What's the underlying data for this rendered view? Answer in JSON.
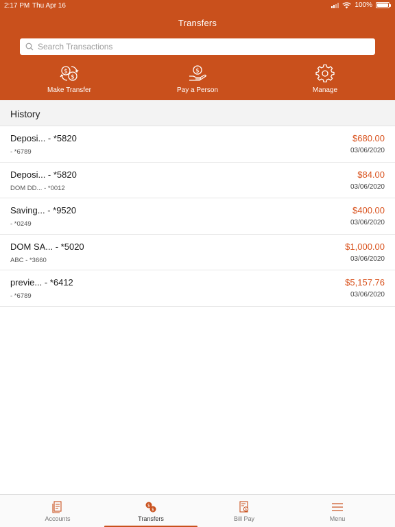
{
  "colors": {
    "accent": "#c9501c",
    "amount": "#d9531e"
  },
  "status_bar": {
    "time": "2:17 PM",
    "date": "Thu Apr 16",
    "battery": "100%"
  },
  "header": {
    "title": "Transfers"
  },
  "search": {
    "placeholder": "Search Transactions",
    "value": ""
  },
  "actions": [
    {
      "label": "Make Transfer",
      "icon": "transfer-icon"
    },
    {
      "label": "Pay a Person",
      "icon": "pay-person-icon"
    },
    {
      "label": "Manage",
      "icon": "gear-icon"
    }
  ],
  "history": {
    "title": "History",
    "rows": [
      {
        "name": "Deposi... - *5820",
        "sub": " - *6789",
        "amount": "$680.00",
        "date": "03/06/2020"
      },
      {
        "name": "Deposi... - *5820",
        "sub": "DOM DD... - *0012",
        "amount": "$84.00",
        "date": "03/06/2020"
      },
      {
        "name": "Saving... - *9520",
        "sub": " - *0249",
        "amount": "$400.00",
        "date": "03/06/2020"
      },
      {
        "name": "DOM SA... - *5020",
        "sub": "ABC - *3660",
        "amount": "$1,000.00",
        "date": "03/06/2020"
      },
      {
        "name": "previe... - *6412",
        "sub": " - *6789",
        "amount": "$5,157.76",
        "date": "03/06/2020"
      }
    ]
  },
  "tabs": [
    {
      "label": "Accounts",
      "icon": "accounts-icon"
    },
    {
      "label": "Transfers",
      "icon": "transfers-icon"
    },
    {
      "label": "Bill Pay",
      "icon": "bill-pay-icon"
    },
    {
      "label": "Menu",
      "icon": "menu-icon"
    }
  ]
}
